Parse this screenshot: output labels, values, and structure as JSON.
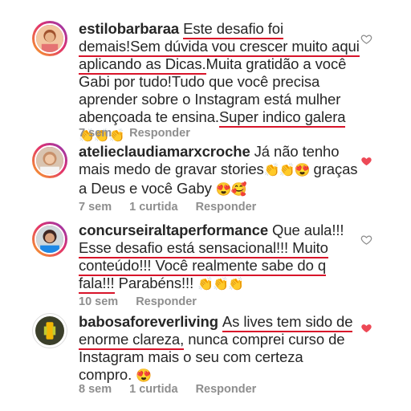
{
  "comments": [
    {
      "username": "estilobarbaraa",
      "text_parts": [
        "Este desafio foi demais!Sem dúvida vou crescer muito aqui aplicando as Dicas.",
        "Muita gratidão  a você Gabi  por tudo!Tudo que você precisa aprender sobre o Instagram está mulher abençoada te ensina.",
        "Super indico galera"
      ],
      "emojis": "👏👏👏",
      "time": "7 sem",
      "likes": "",
      "reply_label": "Responder",
      "liked": false
    },
    {
      "username": "atelieclaudiamarxcroche",
      "text_parts": [
        "Já não tenho mais medo de gravar stories",
        "graças a Deus e você Gaby"
      ],
      "emojis_mid": "👏👏😍",
      "emojis": "😍🥰",
      "time": "7 sem",
      "likes": "1 curtida",
      "reply_label": "Responder",
      "liked": true
    },
    {
      "username": "concurseiraltaperformance",
      "text_parts": [
        "Que aula!!!",
        "Esse desafio está sensacional!!! Muito conteúdo!!! Você realmente sabe do q fala!!!",
        "Parabéns!!!"
      ],
      "emojis": "👏👏👏",
      "time": "10 sem",
      "likes": "",
      "reply_label": "Responder",
      "liked": false
    },
    {
      "username": "babosaforeverliving",
      "text_parts": [
        "As lives tem sido de enorme clareza,",
        "nunca comprei curso de Instagram mais o seu com certeza compro."
      ],
      "emojis": "😍",
      "time": "8 sem",
      "likes": "1 curtida",
      "reply_label": "Responder",
      "liked": true
    }
  ],
  "colors": {
    "heart_liked": "#ed4956",
    "heart_outline": "#8e8e8e",
    "underline": "#d8142a",
    "meta": "#8e8e8e"
  },
  "icons": {
    "like": "heart-icon"
  }
}
